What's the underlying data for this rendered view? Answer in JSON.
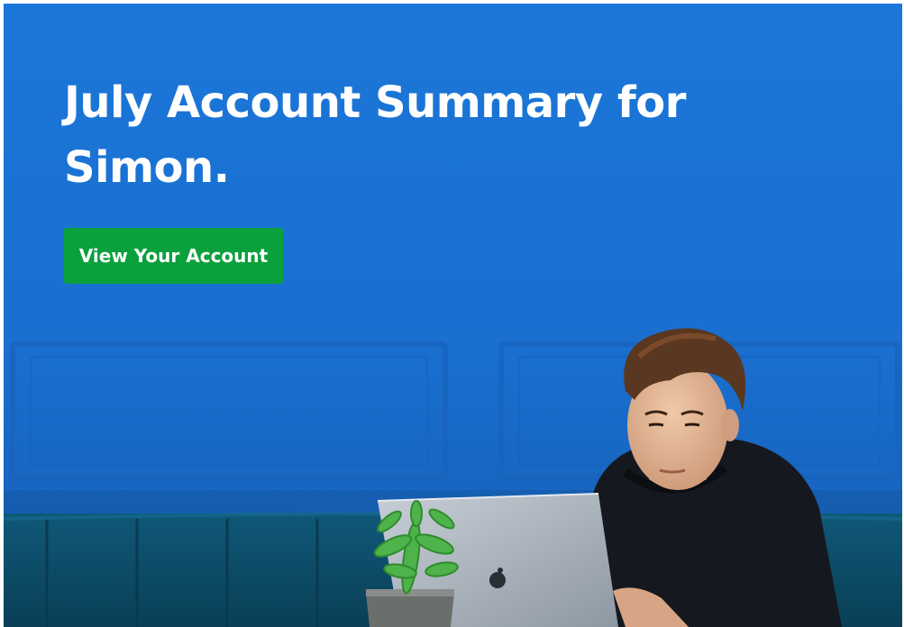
{
  "hero": {
    "headline": "July Account Summary for Simon.",
    "cta_label": "View Your Account"
  },
  "photo": {
    "icon": "photo-man-laptop-plant",
    "colors": {
      "wall": "#1b76d6",
      "sofa": "#0d4f6e",
      "button": "#0aa03c",
      "text": "#ffffff"
    }
  }
}
